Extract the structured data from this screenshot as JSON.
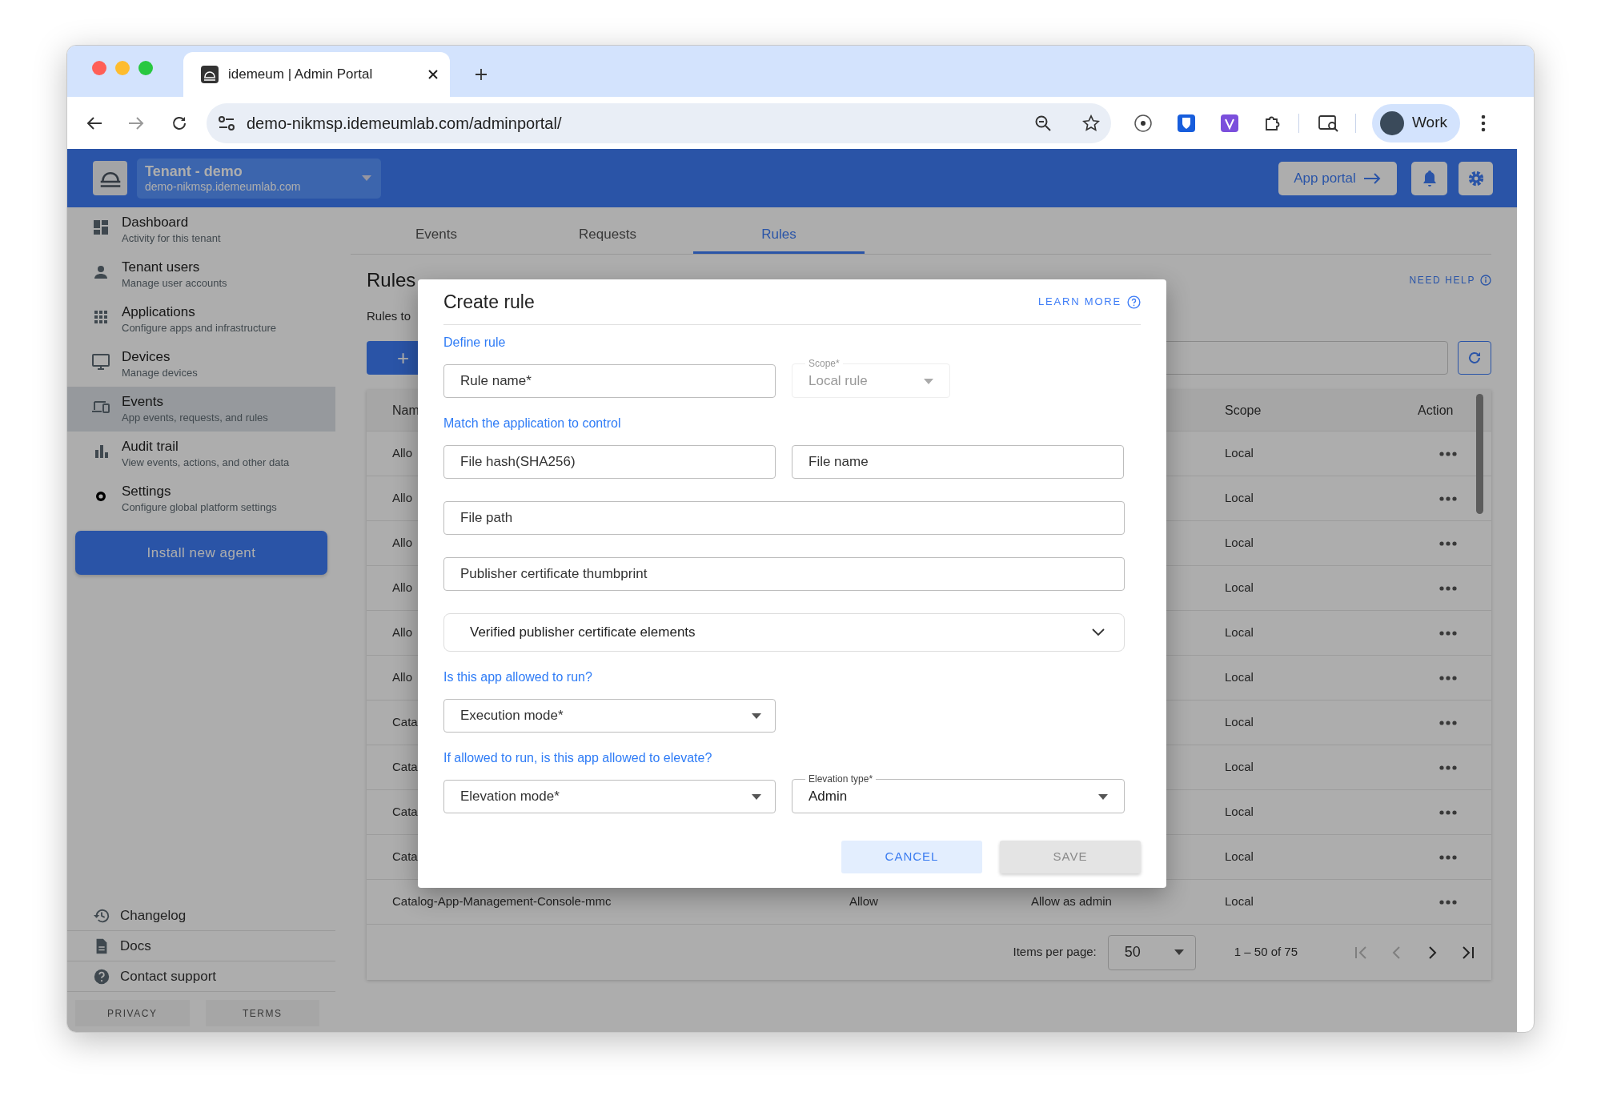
{
  "browser": {
    "tab_title": "idemeum | Admin Portal",
    "url": "demo-nikmsp.idemeumlab.com/adminportal/",
    "profile": "Work"
  },
  "header": {
    "tenant_name": "Tenant - demo",
    "tenant_domain": "demo-nikmsp.idemeumlab.com",
    "app_portal": "App portal"
  },
  "sidebar": {
    "items": [
      {
        "title": "Dashboard",
        "subtitle": "Activity for this tenant",
        "selected": false
      },
      {
        "title": "Tenant users",
        "subtitle": "Manage user accounts",
        "selected": false
      },
      {
        "title": "Applications",
        "subtitle": "Configure apps and infrastructure",
        "selected": false
      },
      {
        "title": "Devices",
        "subtitle": "Manage devices",
        "selected": false
      },
      {
        "title": "Events",
        "subtitle": "App events, requests, and rules",
        "selected": true
      },
      {
        "title": "Audit trail",
        "subtitle": "View events, actions, and other data",
        "selected": false
      },
      {
        "title": "Settings",
        "subtitle": "Configure global platform settings",
        "selected": false
      }
    ],
    "install_button": "Install new agent",
    "footer_links": [
      "Changelog",
      "Docs",
      "Contact support"
    ],
    "legal": [
      "PRIVACY",
      "TERMS"
    ]
  },
  "tabs": [
    {
      "label": "Events",
      "selected": false
    },
    {
      "label": "Requests",
      "selected": false
    },
    {
      "label": "Rules",
      "selected": true
    }
  ],
  "page": {
    "title": "Rules",
    "subtitle": "Rules to",
    "help": "NEED HELP",
    "add_button": "+"
  },
  "table": {
    "columns": {
      "name": "Nam",
      "scope": "Scope",
      "action": "Action"
    },
    "rows": [
      {
        "name": "Allo",
        "scope": "Local"
      },
      {
        "name": "Allo",
        "scope": "Local"
      },
      {
        "name": "Allo",
        "scope": "Local"
      },
      {
        "name": "Allo",
        "scope": "Local"
      },
      {
        "name": "Allo",
        "scope": "Local"
      },
      {
        "name": "Allo",
        "scope": "Local"
      },
      {
        "name": "Cata",
        "scope": "Local"
      },
      {
        "name": "Cata",
        "scope": "Local"
      },
      {
        "name": "Cata",
        "scope": "Local"
      },
      {
        "name": "Cata",
        "scope": "Local"
      },
      {
        "name": "Catalog-App-Management-Console-mmc",
        "column_2": "Allow",
        "column_3": "Allow as admin",
        "scope": "Local"
      }
    ]
  },
  "pagination": {
    "label": "Items per page:",
    "per_page": "50",
    "range": "1 – 50 of 75"
  },
  "dialog": {
    "title": "Create rule",
    "learn_more": "LEARN MORE",
    "sections": [
      {
        "heading": "Define rule",
        "rows": [
          [
            {
              "kind": "text",
              "placeholder": "Rule name*",
              "disabled": false
            },
            {
              "kind": "select",
              "label": "Scope*",
              "value": "Local rule",
              "disabled": true
            }
          ]
        ]
      },
      {
        "heading": "Match the application to control",
        "rows": [
          [
            {
              "kind": "text",
              "placeholder": "File hash(SHA256)",
              "disabled": false
            },
            {
              "kind": "text",
              "placeholder": "File name",
              "disabled": false
            }
          ],
          [
            {
              "kind": "text",
              "placeholder": "File path",
              "disabled": false
            }
          ],
          [
            {
              "kind": "text",
              "placeholder": "Publisher certificate thumbprint",
              "disabled": false
            }
          ],
          [
            {
              "kind": "expander",
              "label": "Verified publisher certificate elements",
              "expanded": false,
              "disabled": false
            }
          ]
        ]
      },
      {
        "heading": "Is this app allowed to run?",
        "rows": [
          [
            {
              "kind": "select",
              "placeholder": "Execution mode*",
              "disabled": false
            }
          ]
        ]
      },
      {
        "heading": "If allowed to run, is this app allowed to elevate?",
        "rows": [
          [
            {
              "kind": "select",
              "placeholder": "Elevation mode*",
              "disabled": false
            },
            {
              "kind": "select",
              "label": "Elevation type*",
              "value": "Admin",
              "disabled": false
            }
          ]
        ]
      }
    ],
    "buttons": [
      {
        "label": "CANCEL",
        "disabled": false
      },
      {
        "label": "SAVE",
        "disabled": true
      }
    ]
  }
}
